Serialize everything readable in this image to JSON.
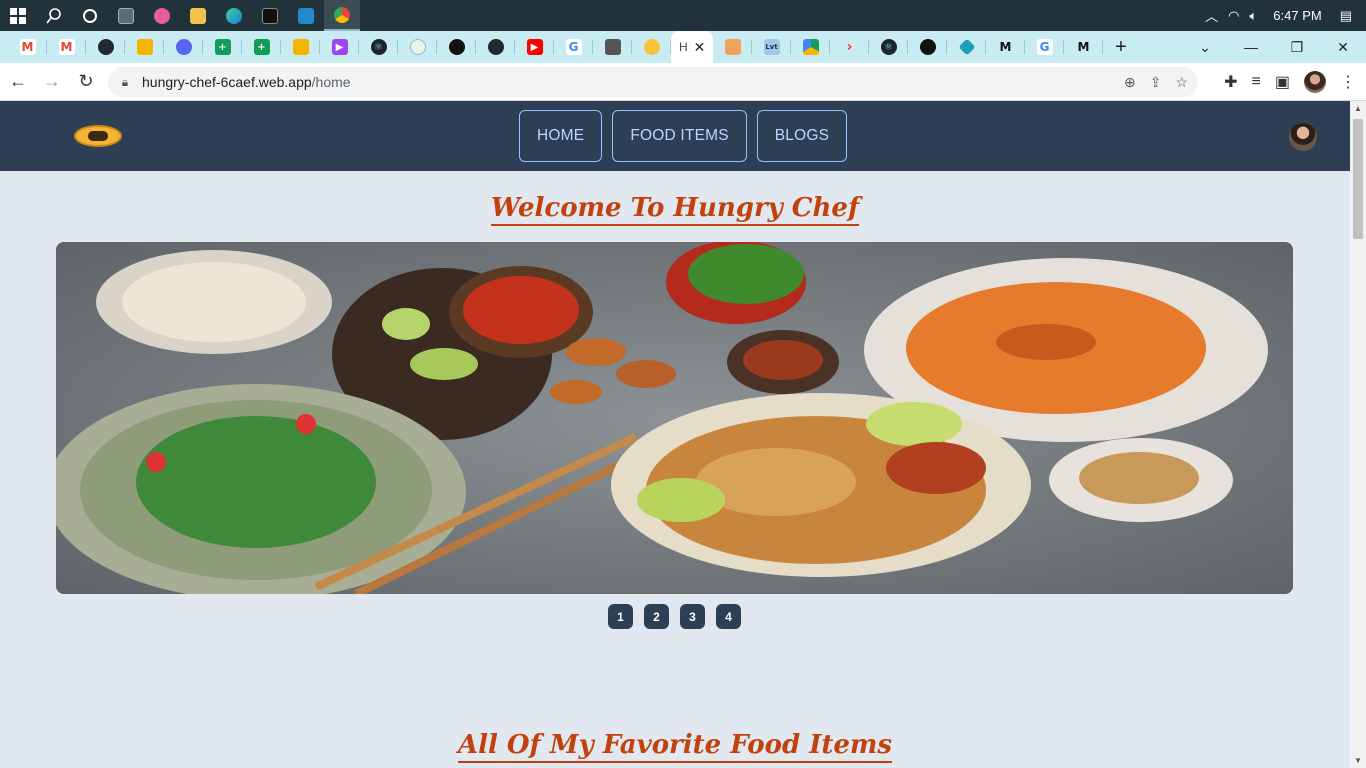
{
  "taskbar": {
    "clock": "6:47 PM"
  },
  "browser": {
    "url_host": "hungry-chef-6caef.web.app",
    "url_path": "/home",
    "active_tab_initial": "H"
  },
  "site": {
    "nav": [
      "HOME",
      "FOOD ITEMS",
      "BLOGS"
    ],
    "welcome_heading": "Welcome To Hungry Chef",
    "favorites_heading": "All Of My Favorite Food Items",
    "carousel_pages": [
      "1",
      "2",
      "3",
      "4"
    ]
  },
  "colors": {
    "nav_bg": "#2e3e55",
    "page_bg": "#e2e8f0",
    "heading": "#c2410c",
    "tabstrip": "#c9ecf3"
  }
}
